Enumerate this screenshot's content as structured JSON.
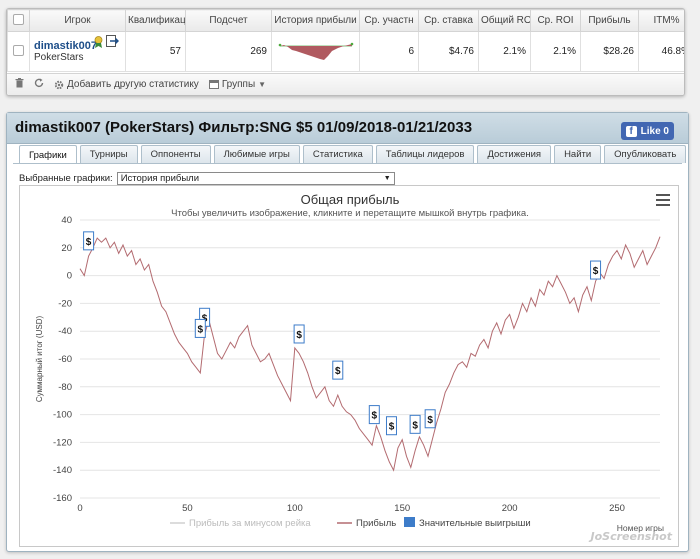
{
  "stats": {
    "headers": [
      "Игрок",
      "Квалификац",
      "Подсчет",
      "История прибыли",
      "Ср. участн",
      "Ср. ставка",
      "Общий RO",
      "Ср. ROI",
      "Прибыль",
      "ITM%"
    ],
    "row": {
      "player_name": "dimastik007",
      "room": "PokerStars",
      "qualification": "57",
      "count": "269",
      "avg_entrants": "6",
      "avg_stake": "$4.76",
      "total_roi": "2.1%",
      "avg_roi": "2.1%",
      "profit": "$28.26",
      "itm": "46.8%",
      "close": "x"
    },
    "footer": {
      "add_stat": "Добавить другую статистику",
      "groups": "Группы"
    }
  },
  "panel": {
    "title": "dimastik007 (PokerStars) Фильтр:SNG $5 01/09/2018-01/21/2033",
    "fb_like": "Like 0",
    "tabs": [
      "Графики",
      "Турниры",
      "Оппоненты",
      "Любимые игры",
      "Статистика",
      "Таблицы лидеров",
      "Достижения",
      "Найти",
      "Опубликовать"
    ],
    "active_tab": "Графики",
    "selector_label": "Выбранные графики:",
    "selector_value": "История прибыли"
  },
  "chart_data": {
    "type": "line",
    "title": "Общая прибыль",
    "subtitle": "Чтобы увеличить изображение, кликните и перетащите мышкой внутрь графика.",
    "ylabel": "Суммарный итог (USD)",
    "xlabel": "Номер игры",
    "xlim": [
      0,
      270
    ],
    "ylim": [
      -160,
      40
    ],
    "xticks": [
      0,
      50,
      100,
      150,
      200,
      250
    ],
    "yticks": [
      40,
      20,
      0,
      -20,
      -40,
      -60,
      -80,
      -100,
      -120,
      -140,
      -160
    ],
    "legend": [
      "Прибыль за минусом рейка",
      "Прибыль",
      "Значительные выигрыши"
    ],
    "legend_placement": "bottom",
    "colors": {
      "profit": "#b36b70",
      "rake": "#d0d0d0",
      "flag": "#3d7cc9"
    },
    "series": [
      {
        "name": "Прибыль",
        "points": [
          [
            0,
            5
          ],
          [
            2,
            0
          ],
          [
            4,
            14
          ],
          [
            6,
            20
          ],
          [
            8,
            27
          ],
          [
            10,
            24
          ],
          [
            12,
            27
          ],
          [
            14,
            20
          ],
          [
            16,
            24
          ],
          [
            18,
            16
          ],
          [
            20,
            22
          ],
          [
            22,
            14
          ],
          [
            24,
            18
          ],
          [
            26,
            8
          ],
          [
            28,
            12
          ],
          [
            30,
            4
          ],
          [
            32,
            8
          ],
          [
            34,
            -4
          ],
          [
            36,
            -12
          ],
          [
            38,
            -22
          ],
          [
            40,
            -26
          ],
          [
            42,
            -34
          ],
          [
            44,
            -42
          ],
          [
            46,
            -48
          ],
          [
            48,
            -52
          ],
          [
            50,
            -56
          ],
          [
            52,
            -62
          ],
          [
            54,
            -66
          ],
          [
            56,
            -70
          ],
          [
            58,
            -42
          ],
          [
            60,
            -32
          ],
          [
            62,
            -44
          ],
          [
            64,
            -56
          ],
          [
            66,
            -60
          ],
          [
            68,
            -54
          ],
          [
            70,
            -48
          ],
          [
            72,
            -52
          ],
          [
            74,
            -44
          ],
          [
            76,
            -40
          ],
          [
            78,
            -36
          ],
          [
            80,
            -50
          ],
          [
            82,
            -56
          ],
          [
            84,
            -62
          ],
          [
            86,
            -60
          ],
          [
            88,
            -56
          ],
          [
            90,
            -64
          ],
          [
            92,
            -72
          ],
          [
            94,
            -78
          ],
          [
            96,
            -84
          ],
          [
            98,
            -90
          ],
          [
            100,
            -52
          ],
          [
            102,
            -56
          ],
          [
            104,
            -62
          ],
          [
            106,
            -70
          ],
          [
            108,
            -80
          ],
          [
            110,
            -88
          ],
          [
            112,
            -84
          ],
          [
            114,
            -80
          ],
          [
            116,
            -90
          ],
          [
            118,
            -94
          ],
          [
            120,
            -86
          ],
          [
            122,
            -94
          ],
          [
            124,
            -98
          ],
          [
            126,
            -100
          ],
          [
            128,
            -104
          ],
          [
            130,
            -110
          ],
          [
            132,
            -114
          ],
          [
            134,
            -118
          ],
          [
            136,
            -122
          ],
          [
            138,
            -108
          ],
          [
            140,
            -116
          ],
          [
            142,
            -126
          ],
          [
            144,
            -134
          ],
          [
            146,
            -140
          ],
          [
            148,
            -124
          ],
          [
            150,
            -118
          ],
          [
            152,
            -130
          ],
          [
            154,
            -138
          ],
          [
            156,
            -126
          ],
          [
            158,
            -116
          ],
          [
            160,
            -122
          ],
          [
            162,
            -130
          ],
          [
            164,
            -118
          ],
          [
            166,
            -106
          ],
          [
            168,
            -96
          ],
          [
            170,
            -84
          ],
          [
            172,
            -78
          ],
          [
            174,
            -70
          ],
          [
            176,
            -64
          ],
          [
            178,
            -62
          ],
          [
            180,
            -66
          ],
          [
            182,
            -56
          ],
          [
            184,
            -58
          ],
          [
            186,
            -50
          ],
          [
            188,
            -46
          ],
          [
            190,
            -52
          ],
          [
            192,
            -40
          ],
          [
            194,
            -34
          ],
          [
            196,
            -42
          ],
          [
            198,
            -32
          ],
          [
            200,
            -28
          ],
          [
            202,
            -38
          ],
          [
            204,
            -30
          ],
          [
            206,
            -20
          ],
          [
            208,
            -26
          ],
          [
            210,
            -16
          ],
          [
            212,
            -22
          ],
          [
            214,
            -10
          ],
          [
            216,
            -14
          ],
          [
            218,
            -4
          ],
          [
            220,
            -8
          ],
          [
            222,
            0
          ],
          [
            224,
            -6
          ],
          [
            226,
            -12
          ],
          [
            228,
            -20
          ],
          [
            230,
            -16
          ],
          [
            232,
            -26
          ],
          [
            234,
            -14
          ],
          [
            236,
            -8
          ],
          [
            238,
            -18
          ],
          [
            240,
            -4
          ],
          [
            242,
            2
          ],
          [
            244,
            -2
          ],
          [
            246,
            8
          ],
          [
            248,
            14
          ],
          [
            250,
            18
          ],
          [
            252,
            12
          ],
          [
            254,
            22
          ],
          [
            256,
            16
          ],
          [
            258,
            6
          ],
          [
            260,
            12
          ],
          [
            262,
            18
          ],
          [
            264,
            8
          ],
          [
            266,
            14
          ],
          [
            268,
            20
          ],
          [
            270,
            28
          ]
        ]
      }
    ],
    "significant_wins": [
      [
        4,
        25
      ],
      [
        58,
        -30
      ],
      [
        56,
        -38
      ],
      [
        102,
        -42
      ],
      [
        120,
        -68
      ],
      [
        137,
        -100
      ],
      [
        145,
        -108
      ],
      [
        156,
        -107
      ],
      [
        163,
        -103
      ],
      [
        240,
        4
      ]
    ]
  }
}
